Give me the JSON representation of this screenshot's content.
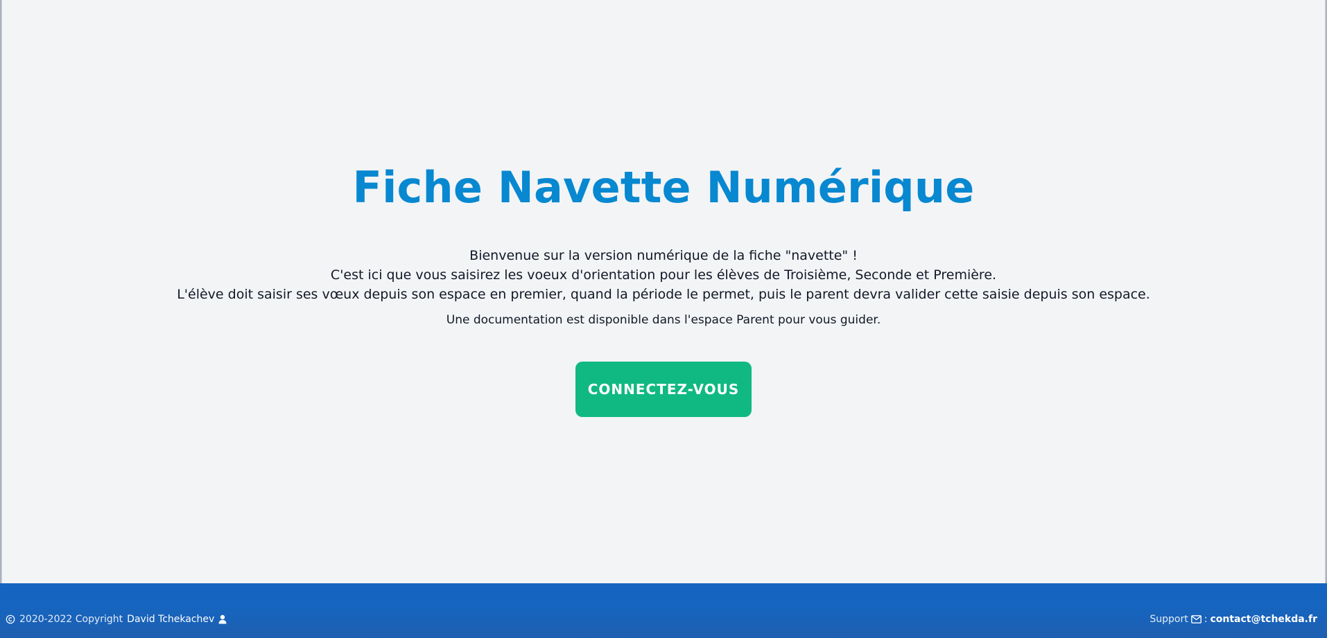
{
  "hero": {
    "title": "Fiche Navette Numérique",
    "intro_lines": [
      "Bienvenue sur la version numérique de la fiche \"navette\" !",
      "C'est ici que vous saisirez les voeux d'orientation pour les élèves de Troisième, Seconde et Première.",
      "L'élève doit saisir ses vœux depuis son espace en premier, quand la période le permet, puis le parent devra valider cette saisie depuis son espace."
    ],
    "doc_note": "Une documentation est disponible dans l'espace Parent pour vous guider.",
    "cta_label": "CONNECTEZ-VOUS"
  },
  "footer": {
    "copyright_icon": "copyright-icon",
    "copyright_text": "2020-2022 Copyright",
    "author": "David Tchekachev",
    "author_icon": "user-icon",
    "support_label": "Support",
    "mail_icon": "envelope-icon",
    "separator": ":",
    "email": "contact@tchekda.fr"
  },
  "colors": {
    "background": "#f3f4f6",
    "title": "#0788d0",
    "cta": "#10b981",
    "footer": "#1565c0"
  }
}
